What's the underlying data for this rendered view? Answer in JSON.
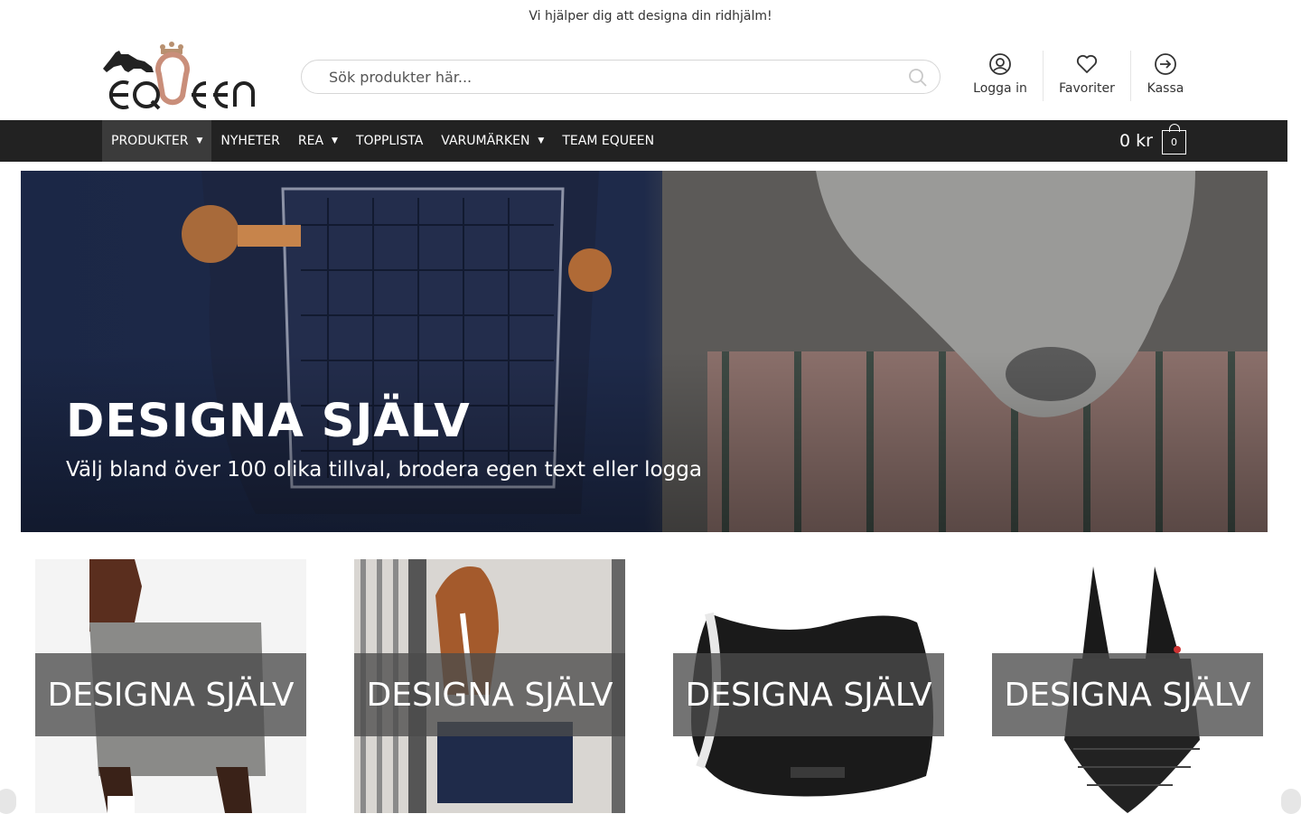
{
  "topbar": {
    "message": "Vi hjälper dig att designa din ridhjälm!"
  },
  "header": {
    "logo_text": "EQUEEN",
    "search_placeholder": "Sök produkter här...",
    "actions": {
      "login": "Logga in",
      "favorites": "Favoriter",
      "checkout": "Kassa"
    }
  },
  "nav": {
    "items": [
      {
        "label": "PRODUKTER",
        "dropdown": true,
        "active": true
      },
      {
        "label": "NYHETER",
        "dropdown": false
      },
      {
        "label": "REA",
        "dropdown": true
      },
      {
        "label": "TOPPLISTA",
        "dropdown": false
      },
      {
        "label": "VARUMÄRKEN",
        "dropdown": true
      },
      {
        "label": "TEAM EQUEEN",
        "dropdown": false
      }
    ],
    "cart_total": "0 kr",
    "cart_count": "0"
  },
  "hero": {
    "title": "DESIGNA SJÄLV",
    "subtitle": "Välj bland över 100 olika tillval, brodera egen text eller logga"
  },
  "categories": [
    {
      "label": "DESIGNA SJÄLV",
      "icon": "horse-blanket-image"
    },
    {
      "label": "DESIGNA SJÄLV",
      "icon": "stable-horse-image"
    },
    {
      "label": "DESIGNA SJÄLV",
      "icon": "saddle-pad-image"
    },
    {
      "label": "DESIGNA SJÄLV",
      "icon": "ear-bonnet-image"
    }
  ],
  "colors": {
    "nav_bg": "#222222",
    "nav_active": "#3b3b3b",
    "hero_navy": "#1a2440",
    "band": "#4b4b4b"
  }
}
